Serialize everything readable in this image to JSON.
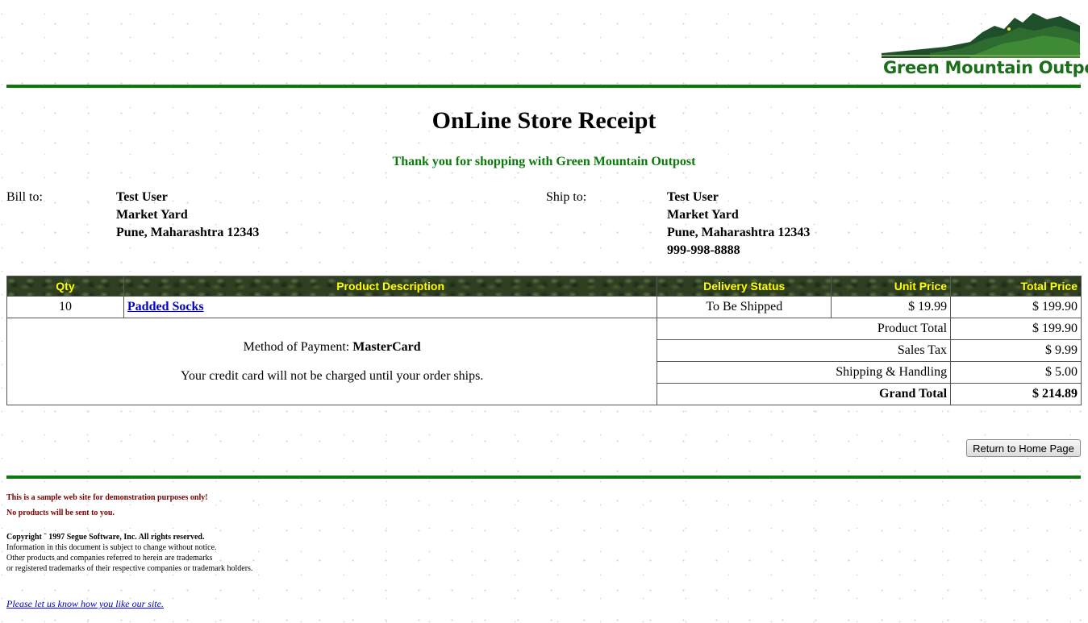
{
  "brand": {
    "name": "Green Mountain Outpost"
  },
  "page": {
    "title": "OnLine Store Receipt",
    "thanks": "Thank you for shopping with Green Mountain Outpost"
  },
  "bill_to": {
    "label": "Bill to:",
    "lines": [
      "Test User",
      "Market Yard",
      "Pune, Maharashtra 12343"
    ]
  },
  "ship_to": {
    "label": "Ship to:",
    "lines": [
      "Test User",
      "Market Yard",
      "Pune, Maharashtra 12343",
      "999-998-8888"
    ]
  },
  "order_table": {
    "headers": [
      "Qty",
      "Product Description",
      "Delivery Status",
      "Unit Price",
      "Total Price"
    ],
    "rows": [
      {
        "qty": "10",
        "product": "Padded Socks",
        "status": "To Be Shipped",
        "unit_price": "$ 19.99",
        "total_price": "$ 199.90"
      }
    ],
    "payment_label": "Method of Payment:",
    "payment_method": "MasterCard",
    "charge_note": "Your credit card will not be charged until your order ships.",
    "summary": [
      {
        "label": "Product Total",
        "value": "$ 199.90"
      },
      {
        "label": "Sales Tax",
        "value": "$ 9.99"
      },
      {
        "label": "Shipping & Handling",
        "value": "$ 5.00"
      }
    ],
    "grand_total": {
      "label": "Grand Total",
      "value": "$ 214.89"
    }
  },
  "return_button": "Return to Home Page",
  "footer": {
    "demo_line1": "This is a sample web site for demonstration purposes only!",
    "demo_line2": "No products will be sent to you.",
    "copyright": "Copyright ¨ 1997 Segue Software, Inc. All rights reserved.",
    "fine_lines": [
      "Information in this document is subject to change without notice.",
      "Other products and companies referred to herein are trademarks",
      "or registered trademarks of their respective companies or trademark holders."
    ],
    "survey_link": "Please let us know how you like our site."
  },
  "colors": {
    "brand_green": "#0b7a0b",
    "header_text": "#ffff00",
    "demo_red": "#7a0000",
    "link_blue": "#0000cc"
  },
  "icons": {
    "logo": "mountain-landscape-logo"
  }
}
